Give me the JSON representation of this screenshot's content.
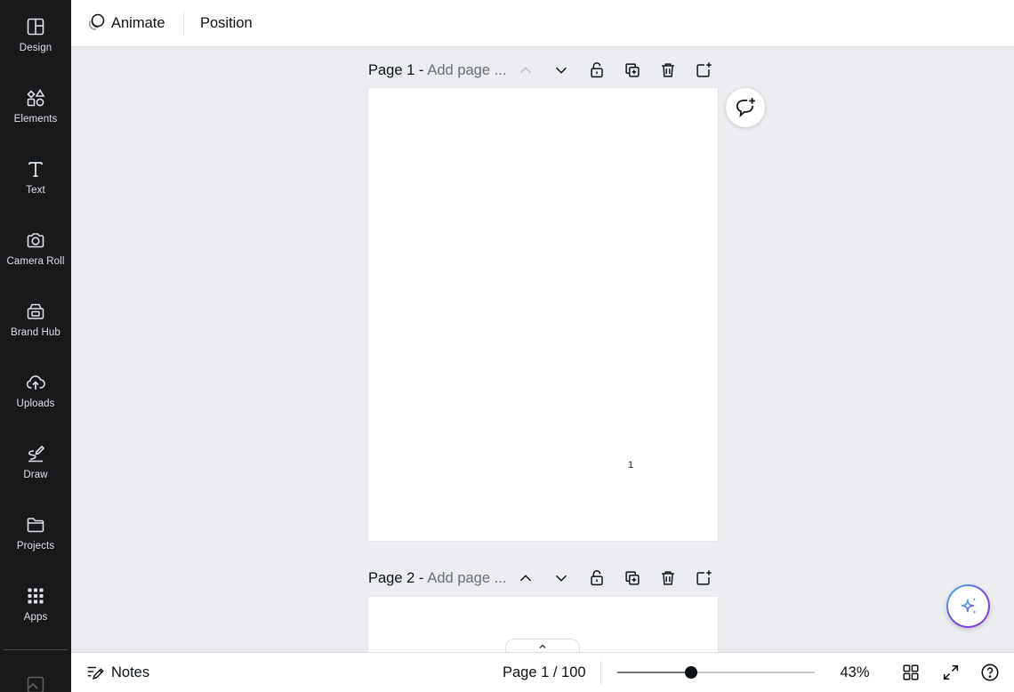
{
  "sidebar": {
    "items": [
      {
        "label": "Design",
        "icon": "design-icon"
      },
      {
        "label": "Elements",
        "icon": "shapes-icon"
      },
      {
        "label": "Text",
        "icon": "text-icon"
      },
      {
        "label": "Camera Roll",
        "icon": "camera-icon"
      },
      {
        "label": "Brand Hub",
        "icon": "brand-icon"
      },
      {
        "label": "Uploads",
        "icon": "cloud-upload-icon"
      },
      {
        "label": "Draw",
        "icon": "draw-icon"
      },
      {
        "label": "Projects",
        "icon": "folder-icon"
      },
      {
        "label": "Apps",
        "icon": "apps-grid-icon"
      }
    ]
  },
  "toolbar": {
    "animate_label": "Animate",
    "position_label": "Position"
  },
  "pages": [
    {
      "label": "Page 1 -",
      "title_placeholder": "Add page ...",
      "page_number": "1"
    },
    {
      "label": "Page 2 -",
      "title_placeholder": "Add page ..."
    }
  ],
  "bottombar": {
    "notes_label": "Notes",
    "page_indicator": "Page 1 / 100",
    "zoom_fraction": 0.43,
    "zoom_label": "43%"
  },
  "colors": {
    "sidebar_bg": "#18191b",
    "canvas_bg": "#ebecf0",
    "accent_gradient_start": "#3fc1e6",
    "accent_gradient_end": "#8e3ed8"
  }
}
